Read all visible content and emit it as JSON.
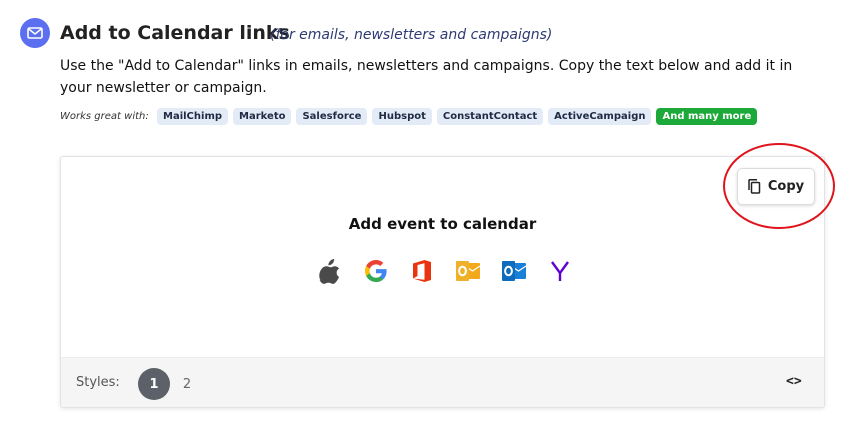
{
  "header": {
    "title": "Add to Calendar links",
    "subtitle": "(for emails, newsletters and campaigns)",
    "description": "Use the \"Add to Calendar\" links in emails, newsletters and campaigns. Copy the text below and add it in your newsletter or campaign."
  },
  "works_with": {
    "label": "Works great with:",
    "tags": [
      "MailChimp",
      "Marketo",
      "Salesforce",
      "Hubspot",
      "ConstantContact",
      "ActiveCampaign"
    ],
    "more": "And many more"
  },
  "preview": {
    "copy_label": "Copy",
    "event_title": "Add event to calendar",
    "calendar_icons": [
      "apple-icon",
      "google-icon",
      "office365-icon",
      "outlook-icon",
      "outlook-com-icon",
      "yahoo-icon"
    ]
  },
  "footer": {
    "styles_label": "Styles:",
    "options": [
      "1",
      "2"
    ],
    "code_toggle": "<>"
  },
  "colors": {
    "accent": "#5b6ff0",
    "more_tag": "#1da83a",
    "annotation": "#e0141c"
  }
}
